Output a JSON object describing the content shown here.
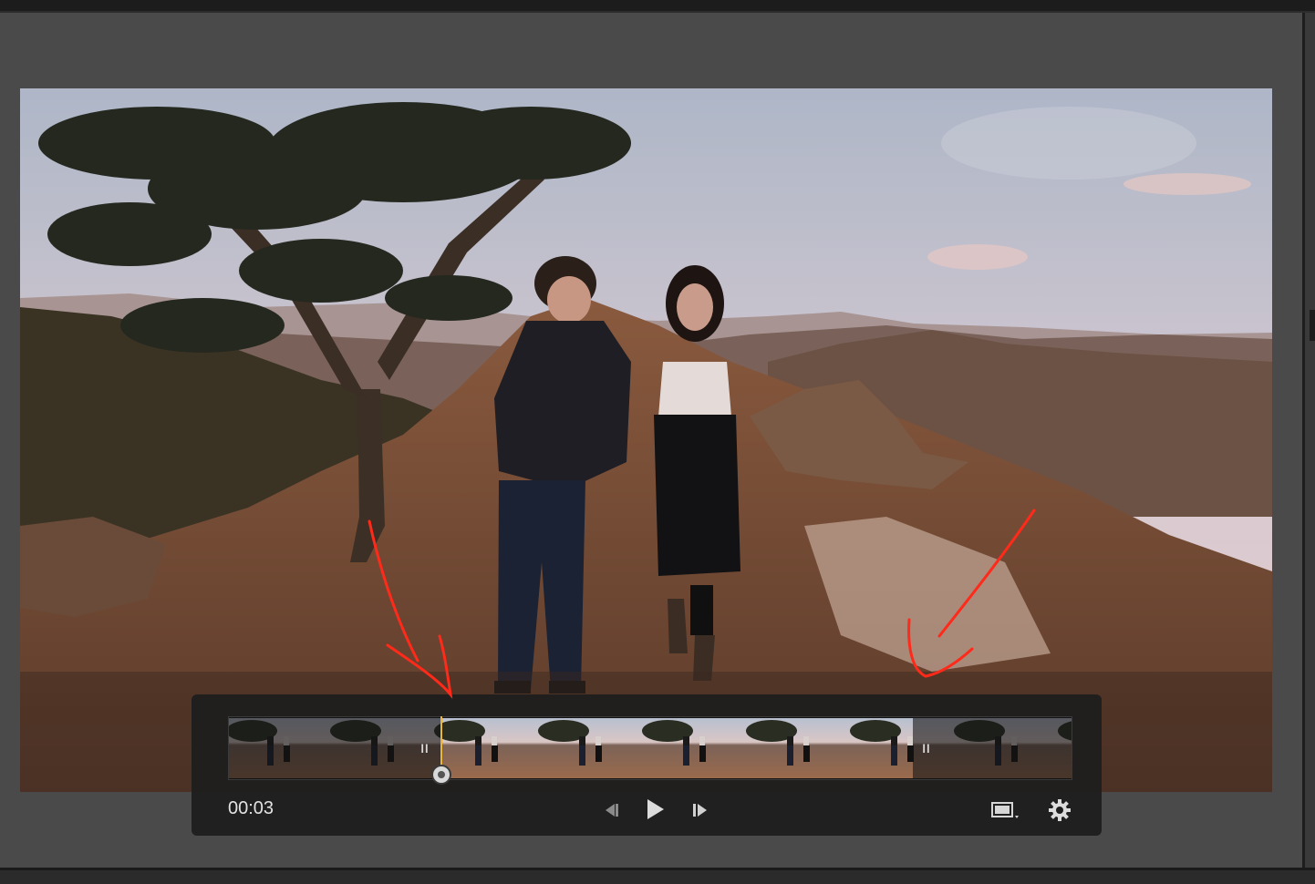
{
  "player": {
    "current_time": "00:03"
  },
  "colors": {
    "playhead": "#e9b53b",
    "annotation": "#ff2a1a",
    "panel_bg": "#1e1e1e"
  },
  "icons": {
    "left_trim": "trim-handle-icon",
    "right_trim": "trim-handle-icon",
    "prev_frame": "previous-frame-icon",
    "play": "play-icon",
    "next_frame": "next-frame-icon",
    "frame_capture": "frame-capture-icon",
    "settings": "gear-icon"
  }
}
